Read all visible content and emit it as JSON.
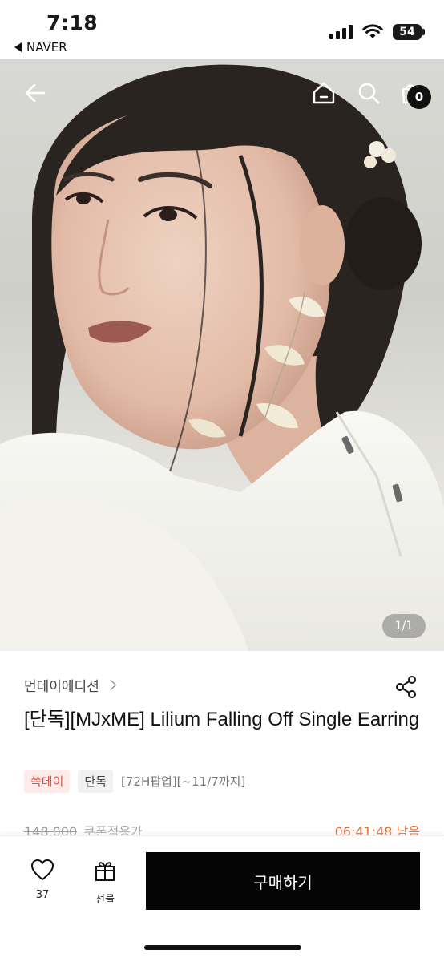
{
  "status_bar": {
    "time": "7:18",
    "back_app": "NAVER",
    "battery": "54"
  },
  "hero": {
    "pager": "1/1",
    "cart_count": "0"
  },
  "product": {
    "brand": "먼데이에디션",
    "title": "[단독][MJxME] Lilium Falling Off Single Earring",
    "tags": {
      "sale": "쓱데이",
      "exclusive": "단독",
      "popup": "[72H팝업][~11/7까지]"
    },
    "price_original": "148,000",
    "coupon_text": "쿠폰적용가",
    "timer": "06:41:48 남음"
  },
  "bottom_bar": {
    "like_count": "37",
    "gift_label": "선물",
    "buy_label": "구매하기"
  },
  "colors": {
    "accent_orange": "#e66a2c",
    "sale_red": "#e0523f",
    "buy_button": "#050505"
  }
}
